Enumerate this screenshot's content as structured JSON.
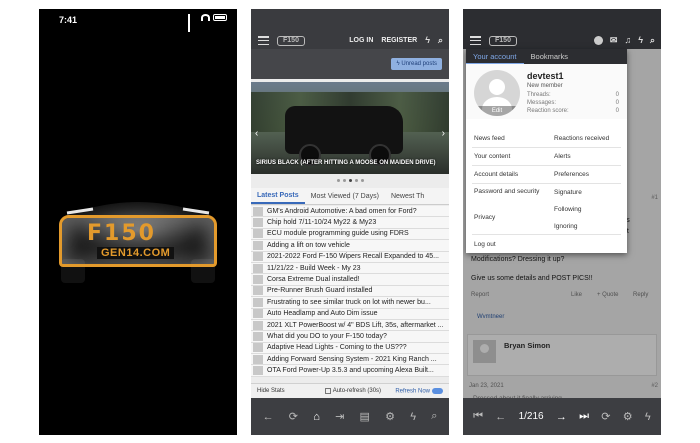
{
  "phone1": {
    "status_time": "7:41",
    "logo_main": "F150",
    "logo_sub": "GEN14.COM"
  },
  "phone2": {
    "header": {
      "login": "LOG IN",
      "register": "REGISTER"
    },
    "unread_button": "Unread posts",
    "hero_caption": "SIRIUS BLACK (AFTER HITTING A MOOSE ON MAIDEN DRIVE)",
    "tabs": [
      "Latest Posts",
      "Most Viewed (7 Days)",
      "Newest Th"
    ],
    "threads": [
      "GM's Android Automotive: A bad omen for Ford?",
      "Chip hold 7/11-10/24 My22 & My23",
      "ECU module programming guide using FDRS",
      "Adding a lift on tow vehicle",
      "2021-2022 Ford F-150 Wipers Recall Expanded to 45...",
      "11/21/22 - Build Week - My 23",
      "Corsa Extreme Dual installed!",
      "Pre-Runner Brush Guard installed",
      "Frustrating to see similar truck on lot with newer bu...",
      "Auto Headlamp and Auto Dim issue",
      "2021 XLT PowerBoost w/ 4\" BDS Lift, 35s, aftermarket ...",
      "What did you DO to your F-150 today?",
      "Adaptive Head Lights - Coming to the US???",
      "Adding Forward Sensing System - 2021 King Ranch ...",
      "OTA Ford Power-Up 3.5.3 and upcoming Alexa Built..."
    ],
    "footer": {
      "hide_stats": "Hide Stats",
      "auto_refresh": "Auto-refresh (30s)",
      "refresh_now": "Refresh Now"
    }
  },
  "phone3": {
    "account_tabs": [
      "Your account",
      "Bookmarks"
    ],
    "username": "devtest1",
    "role": "New member",
    "stats": [
      {
        "label": "Threads:",
        "value": "0"
      },
      {
        "label": "Messages:",
        "value": "0"
      },
      {
        "label": "Reaction score:",
        "value": "0"
      }
    ],
    "avatar_edit": "Edit",
    "links_left": [
      "News feed",
      "Your content",
      "Account details",
      "Password and security",
      "Privacy"
    ],
    "links_right": [
      "Reactions received",
      "Alerts",
      "Preferences",
      "Signature",
      "Following",
      "Ignoring"
    ],
    "logout": "Log out",
    "post_fragment_1": "t's",
    "post_fragment_2": "ut",
    "post_number_1": "#1",
    "post_line_1": "Modifications? Dressing it up?",
    "post_line_2": "Give us some details and POST PICS!!",
    "actions": {
      "report": "Report",
      "like": "Like",
      "quote": "+ Quote",
      "reply": "Reply"
    },
    "reaction_user": "Wvmtneer",
    "reply_user": "Bryan Simon",
    "reply_date": "Jan 23, 2021",
    "post_number_2": "#2",
    "reply_preview": "Dressed about it finally arriving",
    "pager": "1/216"
  }
}
